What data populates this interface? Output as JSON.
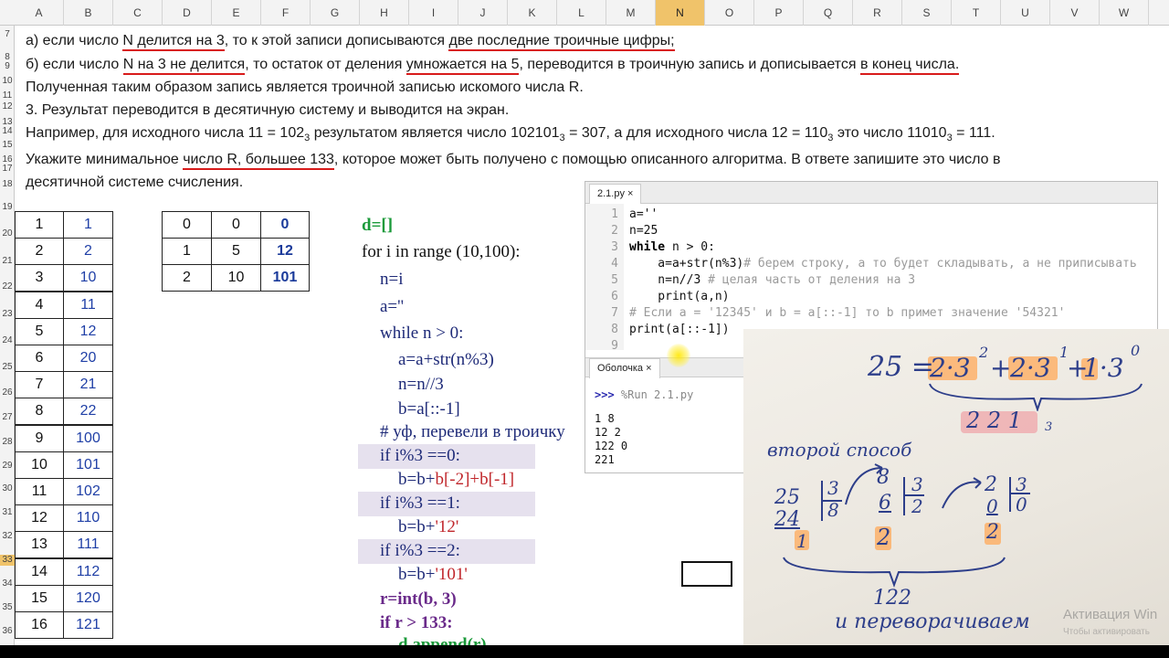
{
  "columns": [
    "A",
    "B",
    "C",
    "D",
    "E",
    "F",
    "G",
    "H",
    "I",
    "J",
    "K",
    "L",
    "M",
    "N",
    "O",
    "P",
    "Q",
    "R",
    "S",
    "T",
    "U",
    "V",
    "W"
  ],
  "selected_column": "N",
  "rows": [
    "7",
    "8",
    "9",
    "10",
    "11",
    "12",
    "13",
    "14",
    "15",
    "16",
    "17",
    "18",
    "19",
    "20",
    "21",
    "22",
    "23",
    "24",
    "25",
    "26",
    "27",
    "28",
    "29",
    "30",
    "31",
    "32",
    "33",
    "34",
    "35",
    "36"
  ],
  "selected_row": "33",
  "task": {
    "line_a_pre": "а) если число ",
    "line_a_u1": "N делится на 3",
    "line_a_mid": ", то к этой записи дописываются ",
    "line_a_u2": "две последние троичные цифры;",
    "line_b_pre": "б) если число ",
    "line_b_u1": "N на 3 не делится",
    "line_b_mid": ", то остаток от деления ",
    "line_b_u2": "умножается на 5",
    "line_b_mid2": ", переводится в троичную запись и дописывается ",
    "line_b_u3": "в конец числа.",
    "line_c": "Полученная таким образом запись является троичной записью искомого числа R.",
    "line_d": "3. Результат переводится в десятичную систему и выводится на экран.",
    "line_e1": "Например, для исходного числа 11 = 102",
    "line_e_sub1": "3",
    "line_e2": " результатом является число 102101",
    "line_e_sub2": "3",
    "line_e3": " = 307, а для исходного числа 12 = 110",
    "line_e_sub3": "3",
    "line_e4": " это число 11010",
    "line_e_sub4": "3",
    "line_e5": " = 111.",
    "line_f_pre": "Укажите минимальное ",
    "line_f_u": "число R, большее 133",
    "line_f_post": ", которое может быть получено с помощью описанного алгоритма. В ответе запишите это число в",
    "line_g": "десятичной системе счисления."
  },
  "table_ab": {
    "a": [
      "1",
      "2",
      "3",
      "4",
      "5",
      "6",
      "7",
      "8",
      "9",
      "10",
      "11",
      "12",
      "13",
      "14",
      "15",
      "16"
    ],
    "b": [
      "1",
      "2",
      "10",
      "11",
      "12",
      "20",
      "21",
      "22",
      "100",
      "101",
      "102",
      "110",
      "111",
      "112",
      "120",
      "121"
    ]
  },
  "table_def": [
    [
      "0",
      "0",
      "0"
    ],
    [
      "1",
      "5",
      "12"
    ],
    [
      "2",
      "10",
      "101"
    ]
  ],
  "code_cells": {
    "c1": "d=[]",
    "c2": "for i in range (10,100):",
    "c3": "n=i",
    "c4": "a=''",
    "c5": "while n > 0:",
    "c6": "a=a+str(n%3)",
    "c7": "n=n//3",
    "c8": "b=a[::-1]",
    "c9": "# уф, перевели в троичку",
    "c10": "if i%3 ==0:",
    "c11a": "b=b+",
    "c11b": "b[-2]+b[-1]",
    "c12": "if i%3 ==1:",
    "c13a": "b=b+",
    "c13b": "'12'",
    "c14": "if i%3 ==2:",
    "c15a": "b=b+",
    "c15b": "'101'",
    "c16": "r=int(b, 3)",
    "c17": "if r > 133:",
    "c18": "d.append(r)"
  },
  "editor": {
    "tab": "2.1.py",
    "close": "×",
    "line_numbers": [
      "1",
      "2",
      "3",
      "4",
      "5",
      "6",
      "7",
      "8",
      "9"
    ],
    "l1": "a=''",
    "l2": "n=25",
    "l3_kw": "while",
    "l3_rest": " n > 0:",
    "l4_code": "    a=a+str(n%3)",
    "l4_cmt": "# берем строку, а то будет складывать, а не приписывать",
    "l5_code": "    n=n//3 ",
    "l5_cmt": "# целая часть от деления на 3",
    "l6": "    print(a,n)",
    "l7": "# Если a = '12345' и b = a[::-1] то b примет значение '54321'",
    "l8": "print(a[::-1])",
    "shell_tab": "Оболочка",
    "shell_prompt": ">>>",
    "shell_cmd": " %Run 2.1.py",
    "shell_out": [
      "1 8",
      "12 2",
      "122 0",
      "221"
    ]
  },
  "whiteboard": {
    "eq_left": "25 =",
    "t1": "2·3",
    "e1": "2",
    "plus1": "+",
    "t2": "2·3",
    "e2": "1",
    "plus2": "+",
    "t3": "1·3",
    "e3": "0",
    "result": "2 2 1",
    "result_sub": "3",
    "method2": "второй способ",
    "d1_top": "25",
    "d1_sub": "24",
    "d1_rem": "1",
    "d1_div": "3",
    "d1_q": "8",
    "d2_top": "8",
    "d2_sub": "6",
    "d2_rem": "2",
    "d2_div": "3",
    "d2_q": "2",
    "d3_top": "2",
    "d3_sub": "0",
    "d3_rem": "2",
    "d3_div": "3",
    "d3_q": "0",
    "r122": "122",
    "flip": "и переворачиваем"
  },
  "watermark": "Активация Win",
  "watermark2": "Чтобы активировать"
}
